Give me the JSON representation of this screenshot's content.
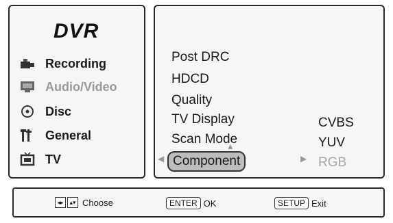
{
  "app": {
    "title": "DVR"
  },
  "sidebar": {
    "items": [
      {
        "label": "Recording",
        "icon": "camera-icon",
        "disabled": false
      },
      {
        "label": "Audio/Video",
        "icon": "monitor-icon",
        "disabled": true
      },
      {
        "label": "Disc",
        "icon": "disc-icon",
        "disabled": false
      },
      {
        "label": "General",
        "icon": "tools-icon",
        "disabled": false
      },
      {
        "label": "TV",
        "icon": "tv-icon",
        "disabled": false
      }
    ]
  },
  "menu": {
    "options": [
      {
        "label": "Post DRC"
      },
      {
        "label": "HDCD"
      },
      {
        "label": "Quality"
      },
      {
        "label": "TV Display"
      },
      {
        "label": "Scan Mode"
      },
      {
        "label": "Component",
        "highlighted": true
      }
    ],
    "submenu": [
      {
        "label": "CVBS",
        "disabled": false
      },
      {
        "label": "YUV",
        "disabled": false
      },
      {
        "label": "RGB",
        "disabled": true
      }
    ]
  },
  "footer": {
    "choose_label": "Choose",
    "enter_key": "ENTER",
    "ok_label": "OK",
    "setup_key": "SETUP",
    "exit_label": "Exit"
  },
  "colors": {
    "panel_bg": "#f6f6f6",
    "highlight": "#bdbdbd",
    "disabled_text": "#9a9a9a"
  }
}
